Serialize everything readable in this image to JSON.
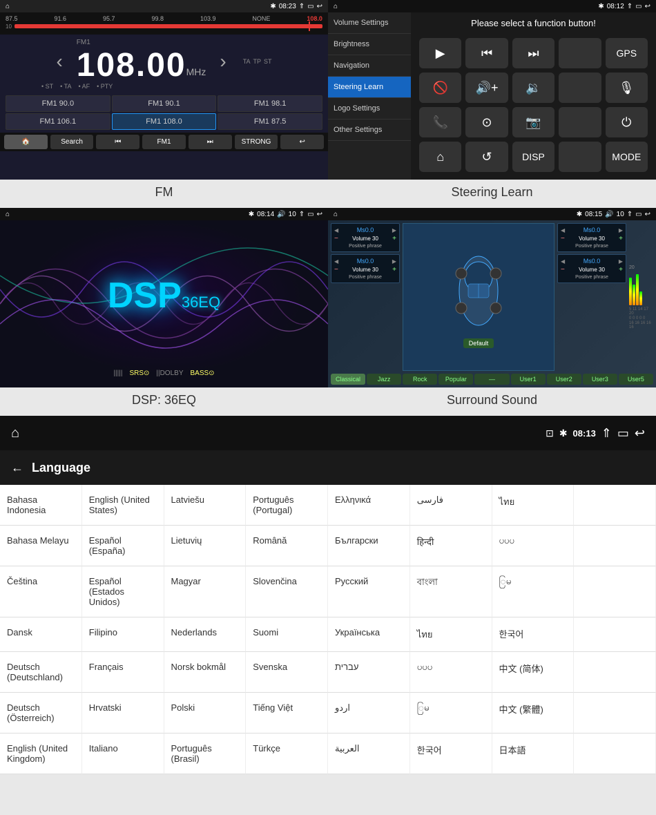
{
  "fm": {
    "label": "FM",
    "time": "08:23",
    "frequency": "108.00",
    "mhz": "MHz",
    "tags": [
      "TA",
      "TP",
      "ST"
    ],
    "freq_points": [
      "87.5",
      "91.6",
      "95.7",
      "99.8",
      "103.9",
      "NONE",
      "108.0"
    ],
    "fm_meta": [
      "ST",
      "TA",
      "AF",
      "PTY"
    ],
    "presets": [
      "FM1 90.0",
      "FM1 90.1",
      "FM1 98.1",
      "FM1 106.1",
      "FM1 108.0",
      "FM1 87.5"
    ],
    "controls": [
      "🏠",
      "Search",
      "⏮",
      "FM1",
      "⏭",
      "STRONG",
      "↩"
    ]
  },
  "steering": {
    "label": "Steering Learn",
    "time": "08:12",
    "title": "Please select a function button!",
    "sidebar_items": [
      "Volume Settings",
      "Brightness",
      "Navigation",
      "Steering Learn",
      "Logo Settings",
      "Other Settings"
    ],
    "active_item": "Steering Learn",
    "gps_label": "GPS",
    "disp_label": "DISP",
    "mode_label": "MODE"
  },
  "dsp": {
    "label": "DSP: 36EQ",
    "time": "08:14",
    "volume": "10",
    "title": "DSP",
    "subtitle": "36EQ",
    "badges": [
      "||||| ",
      "SRS⊙",
      "||DOLBY",
      "BASS⊙"
    ]
  },
  "surround": {
    "label": "Surround Sound",
    "time": "08:15",
    "volume": "10",
    "presets": [
      "Classical",
      "Jazz",
      "Rock",
      "Popular",
      "",
      "User1",
      "User2",
      "User3",
      "User5"
    ],
    "eq_blocks": [
      {
        "title": "Ms0.0",
        "vol": "Volume 30",
        "phrase": "Positive phrase"
      },
      {
        "title": "Ms0.0",
        "vol": "Volume 30",
        "phrase": "Positive phrase"
      },
      {
        "title": "Ms0.0",
        "vol": "Volume 30",
        "phrase": "Positive phrase"
      },
      {
        "title": "Ms0.0",
        "vol": "Volume 30",
        "phrase": "Positive phrase"
      }
    ],
    "default_label": "Default"
  },
  "language": {
    "title": "Language",
    "time": "08:13",
    "back_icon": "←",
    "languages": [
      [
        "Bahasa Indonesia",
        "English (United States)",
        "Latviešu",
        "Português (Portugal)",
        "Ελληνικά",
        "فارسی",
        "ไทย",
        ""
      ],
      [
        "Bahasa Melayu",
        "Español (España)",
        "Lietuvių",
        "Română",
        "Български",
        "हिन्दी",
        "ပပပ",
        ""
      ],
      [
        "Čeština",
        "Español (Estados Unidos)",
        "Magyar",
        "Slovenčina",
        "Русский",
        "বাংলা",
        "ြမ",
        ""
      ],
      [
        "Dansk",
        "Filipino",
        "Nederlands",
        "Suomi",
        "Українська",
        "ไทย",
        "한국어",
        ""
      ],
      [
        "Deutsch (Deutschland)",
        "Français",
        "Norsk bokmål",
        "Svenska",
        "עברית",
        "ပပပ",
        "中文 (简体)",
        ""
      ],
      [
        "Deutsch (Österreich)",
        "Hrvatski",
        "Polski",
        "Tiếng Việt",
        "اردو",
        "ြမ",
        "中文 (繁體)",
        ""
      ],
      [
        "English (United Kingdom)",
        "Italiano",
        "Português (Brasil)",
        "Türkçe",
        "العربية",
        "한국어",
        "日本語",
        ""
      ]
    ]
  }
}
